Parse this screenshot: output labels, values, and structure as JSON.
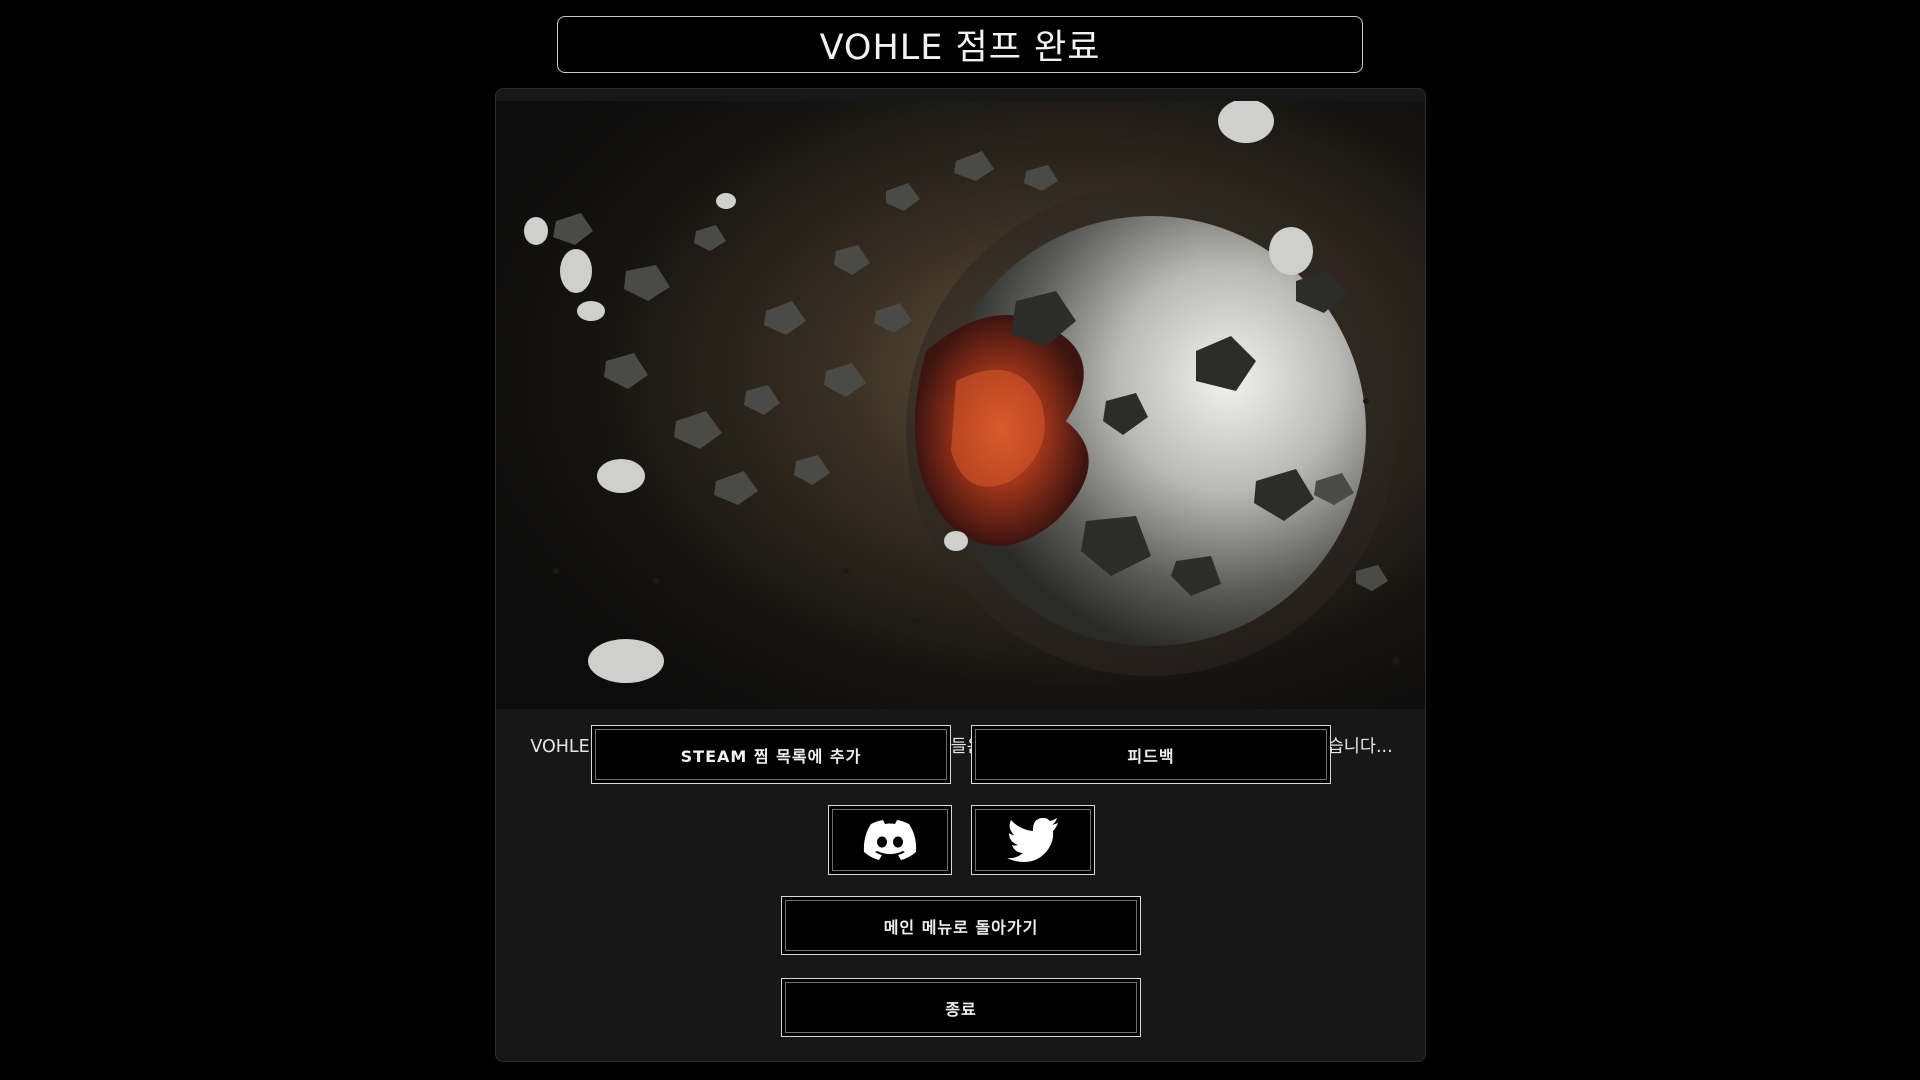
{
  "title": "VOHLE 점프 완료",
  "message": "VOHLE 엔진의 성공적인 첫 테스트를 축하드립니다. 선원들은 자신감 넘치게 여정의 다음 단계를 준비하고 있습니다...",
  "buttons": {
    "wishlist": "STEAM 찜 목록에 추가",
    "feedback": "피드백",
    "main_menu": "메인 메뉴로 돌아가기",
    "quit": "종료"
  },
  "social": {
    "discord_icon": "discord-icon",
    "twitter_icon": "twitter-icon"
  },
  "colors": {
    "background": "#000000",
    "panel": "#171717",
    "button_border": "#d8d8d8",
    "planet_core": "#b8401a"
  }
}
